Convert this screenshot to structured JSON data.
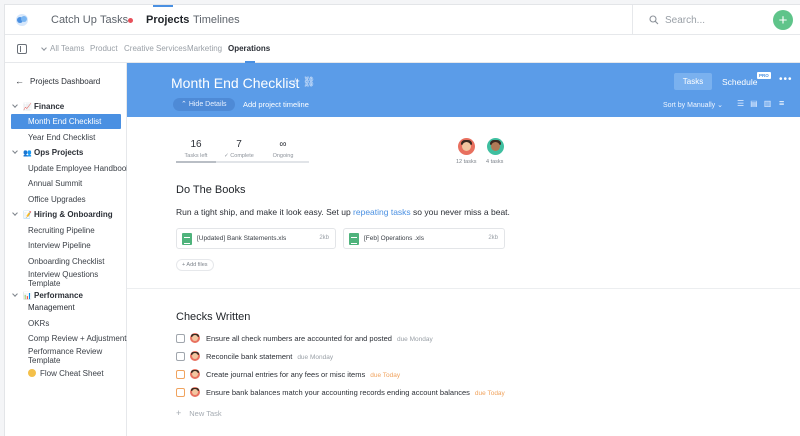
{
  "topnav": {
    "tabs": [
      {
        "label": "Catch Up"
      },
      {
        "label": "Tasks"
      },
      {
        "label": "Projects"
      },
      {
        "label": "Timelines"
      }
    ],
    "search_placeholder": "Search...",
    "add_label": "+"
  },
  "subnav": {
    "items": [
      "All Teams",
      "Product",
      "Creative Services",
      "Marketing",
      "Operations"
    ]
  },
  "sidebar": {
    "back_label": "Projects Dashboard",
    "groups": [
      {
        "label": "Finance",
        "icon": "chart-icon",
        "items": [
          "Month End Checklist",
          "Year End Checklist"
        ]
      },
      {
        "label": "Ops Projects",
        "icon": "people-icon",
        "items": [
          "Update Employee Handbook",
          "Annual Summit",
          "Office Upgrades"
        ]
      },
      {
        "label": "Hiring & Onboarding",
        "icon": "clipboard-icon",
        "items": [
          "Recruiting Pipeline",
          "Interview Pipeline",
          "Onboarding Checklist",
          "Interview Questions",
          "Template"
        ]
      },
      {
        "label": "Performance",
        "label2": "Management",
        "icon": "chart-icon",
        "items": [
          "OKRs",
          "Comp Review + Adjustments",
          "Performance Review",
          "Template",
          "Flow Cheat Sheet"
        ]
      }
    ]
  },
  "project": {
    "title": "Month End Checklist",
    "hide_details": "Hide Details",
    "add_timeline": "Add project timeline",
    "tasks_button": "Tasks",
    "schedule_button": "Schedule",
    "pro_badge": "PRO",
    "sort_label": "Sort by Manually"
  },
  "stats": [
    {
      "num": "16",
      "label": "Tasks left"
    },
    {
      "num": "7",
      "label": "✓ Complete"
    },
    {
      "num": "∞",
      "label": "Ongoing"
    }
  ],
  "progress": 0.3,
  "assignees": [
    {
      "label": "12 tasks"
    },
    {
      "label": "4 tasks"
    }
  ],
  "section1": {
    "title": "Do The Books",
    "desc_before": "Run a tight ship, and make it look easy. Set up ",
    "desc_link": "repeating tasks",
    "desc_after": " so you never miss a beat.",
    "files": [
      {
        "name": "[Updated] Bank Statements.xls",
        "size": "2kb"
      },
      {
        "name": "[Feb] Operations .xls",
        "size": "2kb"
      }
    ],
    "add_files": "+ Add files"
  },
  "section2": {
    "title": "Checks Written",
    "tasks": [
      {
        "text": "Ensure all check numbers are accounted for and posted",
        "due": "due Monday",
        "today": false
      },
      {
        "text": "Reconcile bank statement",
        "due": "due Monday",
        "today": false
      },
      {
        "text": "Create journal entries for any fees or misc items",
        "due": "due Today",
        "today": true
      },
      {
        "text": "Ensure bank balances match your accounting records ending account balances",
        "due": "due Today",
        "today": true
      }
    ],
    "new_task": "New Task"
  },
  "colors": {
    "accent": "#4a90e2",
    "banner": "#5b9ce8",
    "add_button": "#5fc48a",
    "due_today": "#f0a35e"
  }
}
